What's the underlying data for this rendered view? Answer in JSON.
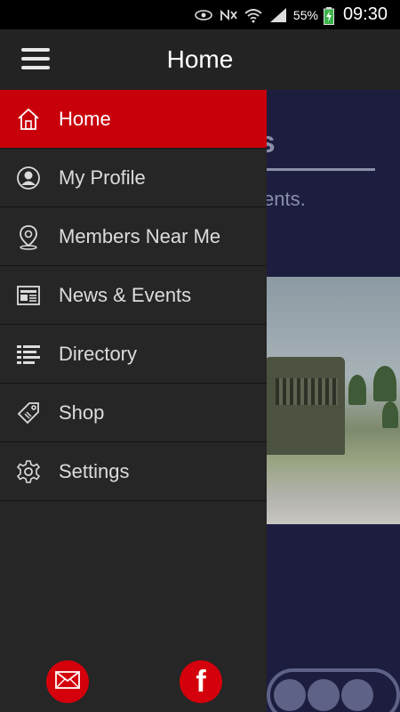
{
  "status_bar": {
    "battery_percent": "55%",
    "time": "09:30",
    "icons": [
      "eye-icon",
      "no-signal-icon",
      "wifi-icon",
      "cell-signal-icon",
      "battery-charging-icon"
    ]
  },
  "app_bar": {
    "title": "Home",
    "menu_icon": "hamburger-icon"
  },
  "background": {
    "heading_fragment": "rters",
    "sub_fragment": "uncements."
  },
  "drawer": {
    "items": [
      {
        "label": "Home",
        "icon": "home-icon",
        "active": true
      },
      {
        "label": "My Profile",
        "icon": "user-icon",
        "active": false
      },
      {
        "label": "Members Near Me",
        "icon": "map-pin-icon",
        "active": false
      },
      {
        "label": "News & Events",
        "icon": "newspaper-icon",
        "active": false
      },
      {
        "label": "Directory",
        "icon": "list-icon",
        "active": false
      },
      {
        "label": "Shop",
        "icon": "tag-icon",
        "active": false
      },
      {
        "label": "Settings",
        "icon": "gear-icon",
        "active": false
      }
    ],
    "footer": {
      "email_icon": "mail-icon",
      "facebook_icon": "facebook-icon",
      "facebook_glyph": "f"
    }
  },
  "colors": {
    "accent": "#c8000a",
    "drawer_bg": "#262626",
    "appbar_bg": "#232323",
    "content_bg": "#1d1e3f"
  }
}
